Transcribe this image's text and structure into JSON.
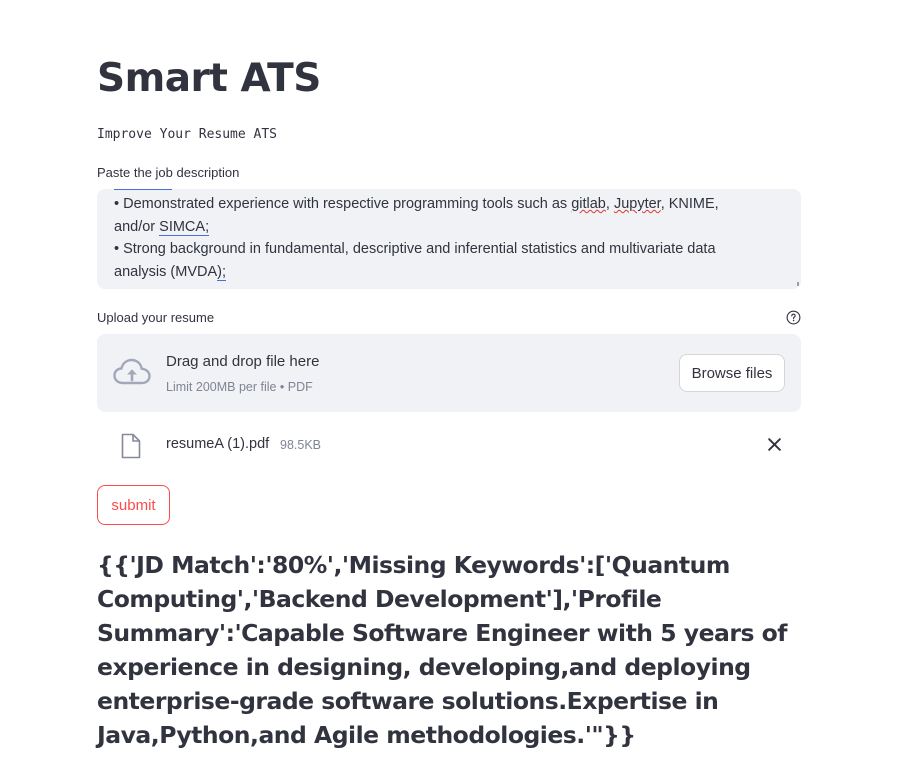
{
  "header": {
    "title": "Smart ATS",
    "subtitle": "Improve Your Resume ATS"
  },
  "job_description": {
    "label": "Paste the job description",
    "lines": [
      "• Demonstrated experience with respective programming tools such as gitlab, Jupyter, KNIME,",
      "and/or SIMCA;",
      "• Strong background in fundamental, descriptive and inferential statistics and multivariate data",
      "analysis (MVDA);"
    ],
    "line1_pre": "• Demonstrated experience with respective programming tools such as ",
    "line1_gitlab": "gitlab",
    "line1_comma1": ", ",
    "line1_jupyter": "Jupyter",
    "line1_post": ", KNIME,",
    "line2_pre": "and/or ",
    "line2_simca": "SIMCA;",
    "line3": "• Strong background in fundamental, descriptive and inferential statistics and multivariate data",
    "line4_pre": "analysis (MVDA",
    "line4_post": ");"
  },
  "uploader": {
    "label": "Upload your resume",
    "drop_text": "Drag and drop file here",
    "limit_text": "Limit 200MB per file • PDF",
    "browse_label": "Browse files",
    "file_name": "resumeA (1).pdf",
    "file_size": "98.5KB"
  },
  "submit_label": "submit",
  "result_text": "{{'JD Match':'80%','Missing Keywords':['Quantum Computing','Backend Development'],'Profile Summary':'Capable Software Engineer with 5 years of experience in designing, developing,and deploying enterprise-grade software solutions.Expertise in Java,Python,and Agile methodologies.'\"}}",
  "colors": {
    "accent": "#ff4b4b",
    "text": "#31333f",
    "muted": "#808495",
    "field_bg": "#f0f2f6"
  }
}
